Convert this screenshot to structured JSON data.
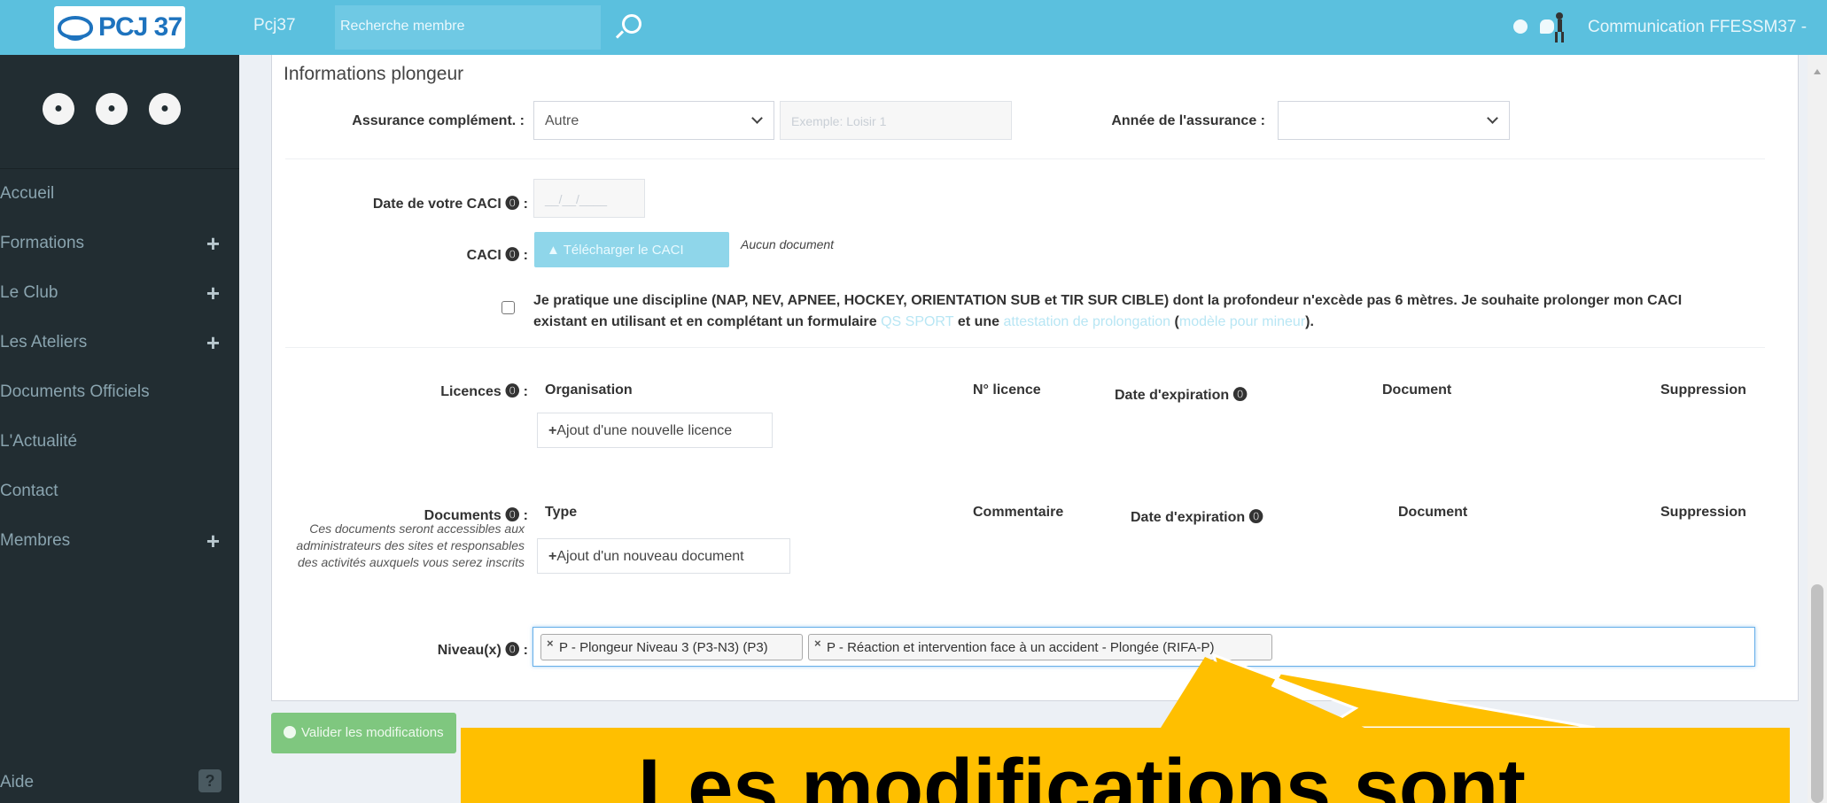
{
  "topbar": {
    "logo_text": "PCJ 37",
    "brand": "Pcj37",
    "search_placeholder": "Recherche membre",
    "user_name": "Communication FFESSM37 -"
  },
  "sidebar": {
    "icons": [
      "bell-icon",
      "users-icon",
      "comments-icon"
    ],
    "items": [
      {
        "label": "Accueil",
        "has_submenu": false
      },
      {
        "label": "Formations",
        "has_submenu": true
      },
      {
        "label": "Le Club",
        "has_submenu": true
      },
      {
        "label": "Les Ateliers",
        "has_submenu": true
      },
      {
        "label": "Documents Officiels",
        "has_submenu": false
      },
      {
        "label": "L'Actualité",
        "has_submenu": false
      },
      {
        "label": "Contact",
        "has_submenu": false
      },
      {
        "label": "Membres",
        "has_submenu": true
      }
    ],
    "plus": "+",
    "help_label": "Aide",
    "help_icon": "?"
  },
  "form": {
    "section_title": "Informations plongeur",
    "assurance_label": "Assurance complément. :",
    "assurance_value": "Autre",
    "assurance_example_placeholder": "Exemple: Loisir 1",
    "annee_label": "Année de l'assurance :",
    "annee_value": "",
    "caci_date_label": "Date de votre CACI ⓿ :",
    "caci_date_placeholder": "__/__/____",
    "caci_label": "CACI ⓿ :",
    "caci_upload_button": "Télécharger le CACI",
    "caci_no_doc": "Aucun document",
    "caci_checkbox_text_1": "Je pratique une discipline (NAP, NEV, APNEE, HOCKEY, ORIENTATION SUB et TIR SUR CIBLE) dont la profondeur n'excède pas 6 mètres. Je souhaite prolonger mon CACI existant en utilisant et en complétant un formulaire ",
    "caci_link_qs": "QS SPORT",
    "caci_checkbox_text_2": " et une ",
    "caci_link_attest": "attestation de prolongation",
    "caci_checkbox_text_3": " (",
    "caci_link_minor": "modèle pour mineur",
    "caci_checkbox_text_4": ").",
    "licences_label": "Licences ⓿ :",
    "licences_columns": [
      "Organisation",
      "N° licence",
      "Date d'expiration ⓿",
      "Document",
      "Suppression"
    ],
    "licences_add_button": "Ajout d'une nouvelle licence",
    "documents_label": "Documents ⓿ :",
    "documents_help": "Ces documents seront accessibles aux administrateurs des sites et responsables des activités auxquels vous serez inscrits",
    "documents_columns": [
      "Type",
      "Commentaire",
      "Date d'expiration ⓿",
      "Document",
      "Suppression"
    ],
    "documents_add_button": "Ajout d'un nouveau document",
    "niveaux_label": "Niveau(x) ⓿ :",
    "niveaux_tags": [
      "P - Plongeur Niveau 3 (P3-N3) (P3)",
      "P - Réaction et intervention face à un accident - Plongée (RIFA-P)"
    ],
    "tag_remove": "×",
    "add_plus": "+",
    "save_button": "Valider les modifications"
  },
  "callout": {
    "text": "Les modifications sont",
    "color": "#ffbf00"
  },
  "colors": {
    "topbar": "#5bc0de",
    "sidebar": "#222d32",
    "save": "#7fc77f"
  }
}
